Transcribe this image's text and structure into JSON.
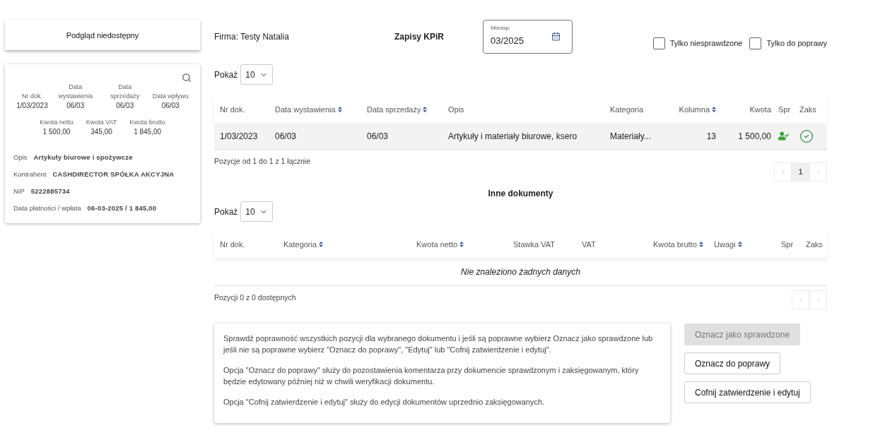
{
  "preview_panel": {
    "text": "Podgląd niedostępny"
  },
  "document_card": {
    "dates": [
      {
        "label": "Nr dok.",
        "value": "1/03/2023"
      },
      {
        "label": "Data wystawienia",
        "value": "06/03"
      },
      {
        "label": "Data sprzedaży",
        "value": "06/03"
      },
      {
        "label": "Data wpływu",
        "value": "06/03"
      }
    ],
    "amounts": [
      {
        "label": "Kwota netto",
        "value": "1 500,00"
      },
      {
        "label": "Kwota VAT",
        "value": "345,00"
      },
      {
        "label": "Kwota brutto",
        "value": "1 845,00"
      }
    ],
    "details": [
      {
        "label": "Opis",
        "value": "Artykuły biurowe i spożywcze"
      },
      {
        "label": "Kontrahent",
        "value": "CASHDIRECTOR SPÓŁKA AKCYJNA"
      },
      {
        "label": "NIP",
        "value": "5222885734"
      },
      {
        "label": "Data płatności / wpłata",
        "value": "06-03-2025 / 1 845,00"
      }
    ]
  },
  "header": {
    "company": "Firma: Testy Natalia",
    "title": "Zapisy KPiR",
    "month_field": {
      "label": "Miesiąc",
      "value": "03/2025"
    },
    "filters": [
      {
        "label": "Tylko niesprawdzone",
        "checked": false
      },
      {
        "label": "Tylko do poprawy",
        "checked": false
      }
    ]
  },
  "entries": {
    "page_size": {
      "label": "Pokaż",
      "value": "10"
    },
    "columns": [
      {
        "label": "Nr dok.",
        "sortable": false
      },
      {
        "label": "Data wystawienia",
        "sortable": true
      },
      {
        "label": "Data sprzedaży",
        "sortable": true
      },
      {
        "label": "Opis",
        "sortable": false
      },
      {
        "label": "Kategoria",
        "sortable": false
      },
      {
        "label": "Kolumna",
        "sortable": true
      },
      {
        "label": "Kwota",
        "sortable": false
      },
      {
        "label": "Spr",
        "sortable": false
      },
      {
        "label": "Zaks",
        "sortable": false
      }
    ],
    "rows": [
      {
        "cells": [
          "1/03/2023",
          "06/03",
          "06/03",
          "Artykuły i materiały biurowe, ksero",
          "Materiały...",
          "13",
          "1 500,00"
        ],
        "verified": true,
        "booked": true
      }
    ],
    "summary": "Pozycje od 1 do 1 z 1 łącznie",
    "pages": [
      {
        "label": "1",
        "selected": true
      }
    ]
  },
  "other_documents": {
    "title": "Inne dokumenty",
    "page_size": {
      "label": "Pokaż",
      "value": "10"
    },
    "columns": [
      {
        "label": "Nr dok.",
        "sortable": false
      },
      {
        "label": "Kategoria",
        "sortable": true
      },
      {
        "label": "Kwota netto",
        "sortable": true
      },
      {
        "label": "Stawka VAT",
        "sortable": false
      },
      {
        "label": "VAT",
        "sortable": false
      },
      {
        "label": "Kwota brutto",
        "sortable": true
      },
      {
        "label": "Uwagi",
        "sortable": true
      },
      {
        "label": "Spr",
        "sortable": false
      },
      {
        "label": "Zaks",
        "sortable": false
      }
    ],
    "empty_message": "Nie znaleziono żadnych danych",
    "summary": "Pozycji 0 z 0 dostępnych"
  },
  "info_box": [
    "Sprawdź poprawność wszystkich pozycji dla wybranego dokumentu i jeśli są poprawne wybierz Oznacz jako sprawdzone lub jeśli nie są poprawne wybierz \"Oznacz do poprawy\", \"Edytuj\" lub \"Cofnij zatwierdzenie i edytuj\".",
    "Opcja \"Oznacz do poprawy\" służy do pozostawienia komentarza przy dokumencie sprawdzonym i zaksięgowanym, który będzie edytowany później niż w chwili weryfikacji dokumentu.",
    "Opcja \"Cofnij zatwierdzenie i edytuj\" służy do edycji dokumentów uprzednio zaksięgowanych."
  ],
  "actions": [
    {
      "label": "Oznacz jako sprawdzone",
      "disabled": true
    },
    {
      "label": "Oznacz do poprawy",
      "disabled": false
    },
    {
      "label": "Cofnij zatwierdzenie i edytuj",
      "disabled": false
    }
  ]
}
